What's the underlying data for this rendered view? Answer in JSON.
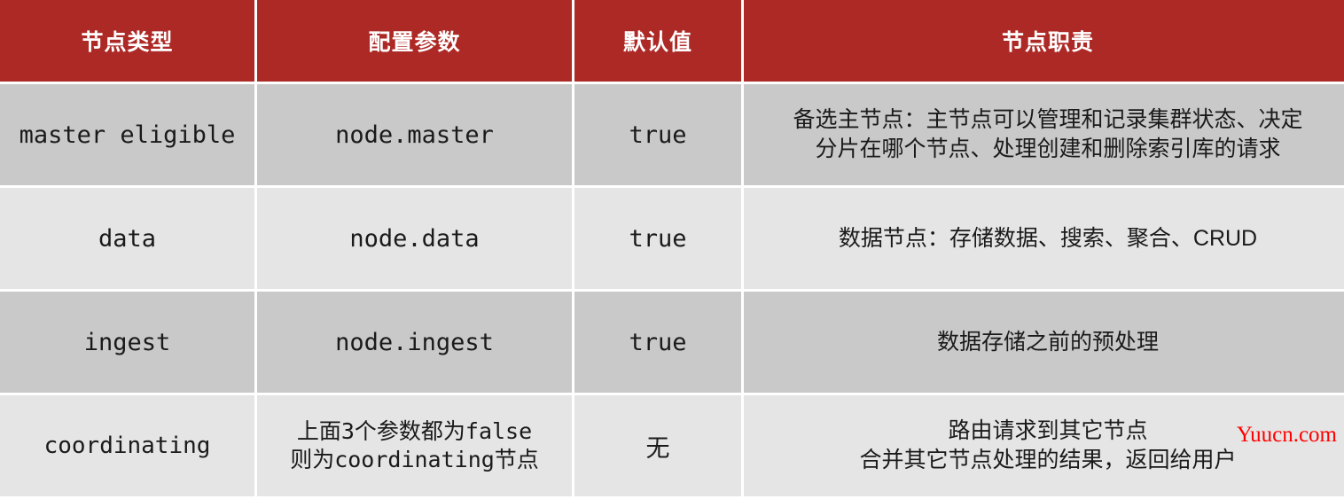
{
  "table": {
    "columns": [
      {
        "key": "type",
        "label": "节点类型"
      },
      {
        "key": "param",
        "label": "配置参数"
      },
      {
        "key": "default",
        "label": "默认值"
      },
      {
        "key": "duty",
        "label": "节点职责"
      }
    ],
    "header_bg": "#ad2926",
    "header_fg": "#ffffff",
    "row_bg_dark": "#c9c9c9",
    "row_bg_light": "#e5e5e5",
    "rows": [
      {
        "type": "master eligible",
        "param": "node.master",
        "default": "true",
        "duty_line1": "备选主节点：主节点可以管理和记录集群状态、决定",
        "duty_line2": "分片在哪个节点、处理创建和删除索引库的请求"
      },
      {
        "type": "data",
        "param": "node.data",
        "default": "true",
        "duty_line1": "数据节点：存储数据、搜索、聚合、CRUD",
        "duty_line2": ""
      },
      {
        "type": "ingest",
        "param": "node.ingest",
        "default": "true",
        "duty_line1": "数据存储之前的预处理",
        "duty_line2": ""
      },
      {
        "type": "coordinating",
        "param_line1": "上面3个参数都为false",
        "param_line2": "则为coordinating节点",
        "default": "无",
        "duty_line1": "路由请求到其它节点",
        "duty_line2": "合并其它节点处理的结果，返回给用户"
      }
    ]
  },
  "watermark": {
    "text": "Yuucn.com",
    "color": "#ff0000"
  }
}
